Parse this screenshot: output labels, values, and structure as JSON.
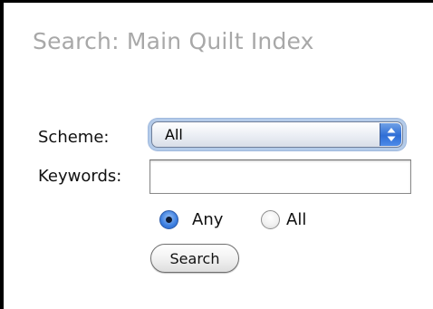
{
  "page": {
    "heading": "Search: Main Quilt Index"
  },
  "form": {
    "scheme_label": "Scheme:",
    "scheme_selected": "All",
    "keywords_label": "Keywords:",
    "keywords_value": "",
    "match_options": [
      {
        "label": "Any",
        "checked": true
      },
      {
        "label": "All",
        "checked": false
      }
    ],
    "search_button_label": "Search"
  },
  "icons": {
    "select_stepper": "up-down-arrows-icon",
    "radio_checked": "radio-checked-icon",
    "radio_unchecked": "radio-unchecked-icon"
  },
  "colors": {
    "heading": "#a8a8a8",
    "focus_ring": "#b4cbe9",
    "accent_blue": "#2f6ed6",
    "frame_border": "#000000"
  }
}
